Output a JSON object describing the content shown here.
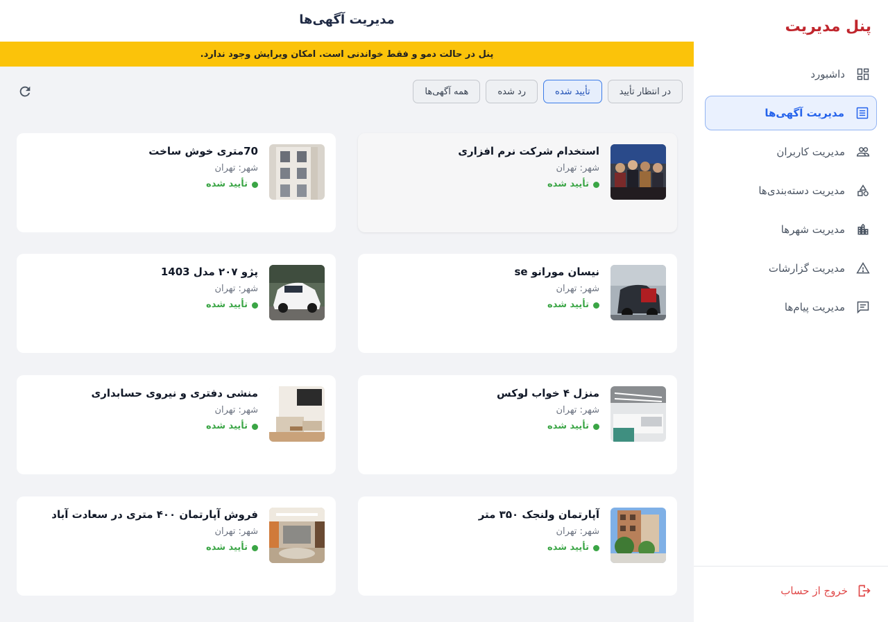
{
  "sidebar": {
    "title": "پنل مدیریت",
    "items": [
      {
        "label": "داشبورد",
        "icon": "dashboard-icon"
      },
      {
        "label": "مدیریت آگهی‌ها",
        "icon": "ads-list-icon",
        "active": true
      },
      {
        "label": "مدیریت کاربران",
        "icon": "users-icon"
      },
      {
        "label": "مدیریت دسته‌بندی‌ها",
        "icon": "categories-icon"
      },
      {
        "label": "مدیریت شهرها",
        "icon": "city-icon"
      },
      {
        "label": "مدیریت گزارشات",
        "icon": "warning-icon"
      },
      {
        "label": "مدیریت پیام‌ها",
        "icon": "message-icon"
      }
    ],
    "logout_label": "خروج از حساب"
  },
  "header": {
    "title": "مدیریت آگهی‌ها",
    "banner": "پنل در حالت دمو و فقط خواندنی است. امکان ویرایش وجود ندارد."
  },
  "filters": [
    {
      "label": "در انتظار تأیید"
    },
    {
      "label": "تأیید شده",
      "active": true
    },
    {
      "label": "رد شده"
    },
    {
      "label": "همه آگهی‌ها"
    }
  ],
  "colors": {
    "accent": "#2563eb",
    "brand": "#c0262d",
    "banner": "#fbc30a",
    "status_approved": "#3aa545"
  },
  "ads": [
    {
      "title": "استخدام شرکت نرم افزاری",
      "city": "شهر: تهران",
      "status": "تأیید شده"
    },
    {
      "title": "70متری خوش ساخت",
      "city": "شهر: تهران",
      "status": "تأیید شده"
    },
    {
      "title": "نیسان مورانو se",
      "city": "شهر: تهران",
      "status": "تأیید شده"
    },
    {
      "title": "پژو ۲۰۷ مدل 1403",
      "city": "شهر: تهران",
      "status": "تأیید شده"
    },
    {
      "title": "منزل ۴ خواب لوکس",
      "city": "شهر: تهران",
      "status": "تأیید شده"
    },
    {
      "title": "منشی دفتری و نیروی حسابداری",
      "city": "شهر: تهران",
      "status": "تأیید شده"
    },
    {
      "title": "آپارتمان ولنجک ۳۵۰ متر",
      "city": "شهر: تهران",
      "status": "تأیید شده"
    },
    {
      "title": "فروش آپارتمان ۴۰۰ متری در سعادت آباد",
      "city": "شهر: تهران",
      "status": "تأیید شده"
    }
  ]
}
